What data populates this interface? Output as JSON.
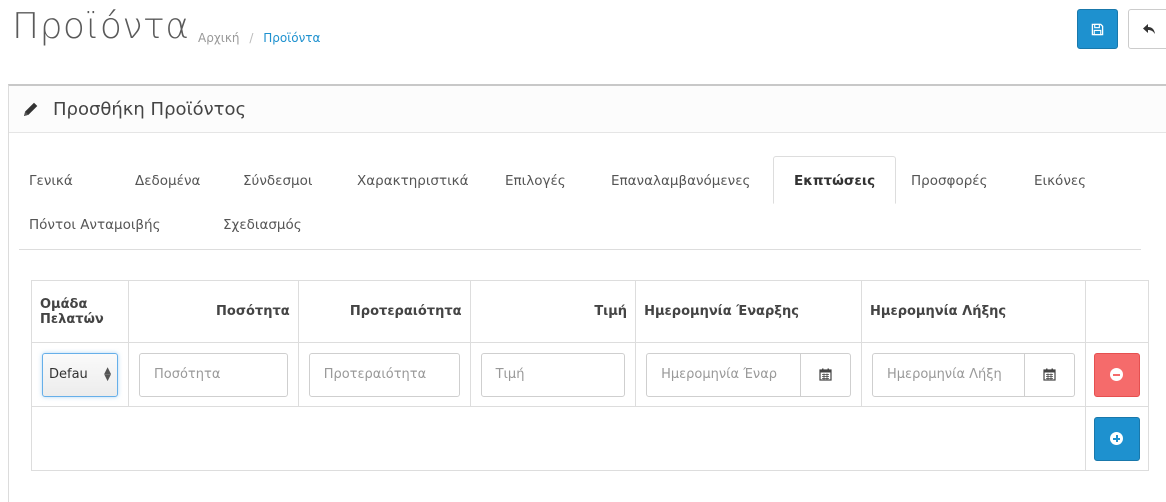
{
  "header": {
    "title": "Προϊόντα",
    "breadcrumb": [
      {
        "label": "Αρχική"
      },
      {
        "label": "Προϊόντα"
      }
    ],
    "breadcrumb_separator": "/",
    "save_icon": "floppy-disk-icon",
    "back_icon": "reply-arrow-icon"
  },
  "panel": {
    "title": "Προσθήκη Προϊόντος",
    "icon": "pencil-icon"
  },
  "tabs": [
    {
      "label": "Γενικά"
    },
    {
      "label": "Δεδομένα"
    },
    {
      "label": "Σύνδεσμοι"
    },
    {
      "label": "Χαρακτηριστικά"
    },
    {
      "label": "Επιλογές"
    },
    {
      "label": "Επαναλαμβανόμενες"
    },
    {
      "label": "Εκπτώσεις"
    },
    {
      "label": "Προσφορές"
    },
    {
      "label": "Εικόνες"
    },
    {
      "label": "Πόντοι Ανταμοιβής"
    },
    {
      "label": "Σχεδιασμός"
    }
  ],
  "active_tab": "Εκπτώσεις",
  "table": {
    "columns": [
      {
        "label": "Ομάδα Πελατών"
      },
      {
        "label": "Ποσότητα"
      },
      {
        "label": "Προτεραιότητα"
      },
      {
        "label": "Τιμή"
      },
      {
        "label": "Ημερομηνία Έναρξης"
      },
      {
        "label": "Ημερομηνία Λήξης"
      }
    ],
    "row": {
      "customer_group": "Defau",
      "quantity_placeholder": "Ποσότητα",
      "priority_placeholder": "Προτεραιότητα",
      "price_placeholder": "Τιμή",
      "date_start_placeholder": "Ημερομηνία Έναρ",
      "date_end_placeholder": "Ημερομηνία Λήξη"
    }
  },
  "colors": {
    "primary": "#1e91cf",
    "danger": "#f56b6b"
  }
}
